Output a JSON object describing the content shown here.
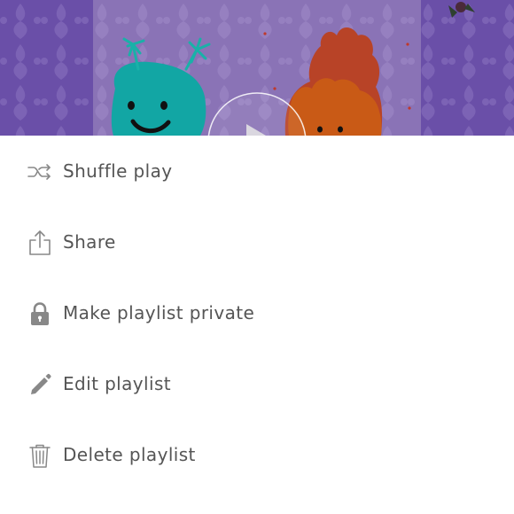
{
  "artwork": {
    "play_icon": "play-circle-icon"
  },
  "menu": {
    "items": [
      {
        "label": "Shuffle play",
        "icon": "shuffle-icon"
      },
      {
        "label": "Share",
        "icon": "share-icon"
      },
      {
        "label": "Make playlist private",
        "icon": "lock-icon"
      },
      {
        "label": "Edit playlist",
        "icon": "pencil-icon"
      },
      {
        "label": "Delete playlist",
        "icon": "trash-icon"
      }
    ]
  },
  "colors": {
    "artwork_background": "#6a4fa8",
    "artwork_panel": "#8a73b6",
    "menu_text": "#555555",
    "icon": "#888888",
    "menu_background": "#ffffff"
  }
}
